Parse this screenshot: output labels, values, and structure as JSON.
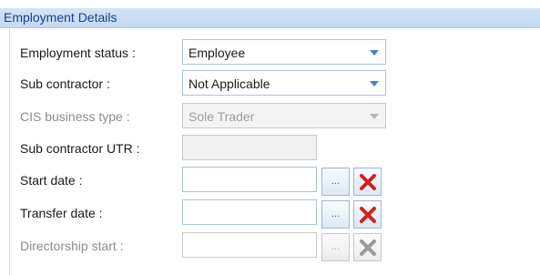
{
  "panel": {
    "title": "Employment Details"
  },
  "fields": {
    "employment_status": {
      "label": "Employment status :",
      "value": "Employee"
    },
    "sub_contractor": {
      "label": "Sub contractor :",
      "value": "Not Applicable"
    },
    "cis_business_type": {
      "label": "CIS business type :",
      "value": "Sole Trader"
    },
    "sub_contractor_utr": {
      "label": "Sub contractor UTR :",
      "value": ""
    },
    "start_date": {
      "label": "Start date :",
      "value": ""
    },
    "transfer_date": {
      "label": "Transfer date :",
      "value": ""
    },
    "directorship_start": {
      "label": "Directorship start :",
      "value": ""
    }
  },
  "buttons": {
    "ellipsis_label": "...",
    "clear_icon": "red-x-icon"
  },
  "colors": {
    "header_bg": "#c5d9f1",
    "header_text": "#15428b",
    "clear_icon_red": "#d42020",
    "clear_icon_disabled": "#9a9a9a"
  }
}
